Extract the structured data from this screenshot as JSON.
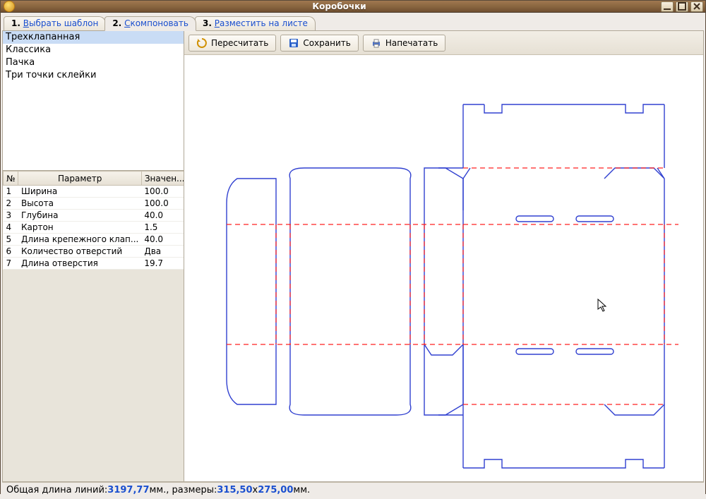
{
  "window": {
    "title": "Коробочки"
  },
  "tabs": [
    {
      "num": "1.",
      "label": "Выбрать шаблон",
      "ukey": "В"
    },
    {
      "num": "2.",
      "label": "Скомпоновать",
      "ukey": "С"
    },
    {
      "num": "3.",
      "label": "Разместить на листе",
      "ukey": "Р"
    }
  ],
  "templates": {
    "items": [
      "Трехклапанная",
      "Классика",
      "Пачка",
      "Три точки склейки"
    ],
    "selected": 0
  },
  "param_headers": {
    "num": "№",
    "name": "Параметр",
    "value": "Значен..."
  },
  "params": [
    {
      "n": "1",
      "name": "Ширина",
      "value": "100.0"
    },
    {
      "n": "2",
      "name": "Высота",
      "value": "100.0"
    },
    {
      "n": "3",
      "name": "Глубина",
      "value": "40.0"
    },
    {
      "n": "4",
      "name": "Картон",
      "value": "1.5"
    },
    {
      "n": "5",
      "name": "Длина крепежного клап...",
      "value": "40.0"
    },
    {
      "n": "6",
      "name": "Количество отверстий",
      "value": "Два"
    },
    {
      "n": "7",
      "name": "Длина отверстия",
      "value": "19.7"
    }
  ],
  "toolbar": {
    "recalc": "Пересчитать",
    "save": "Сохранить",
    "print": "Напечатать"
  },
  "status": {
    "prefix": "Общая длина линий: ",
    "length": "3197,77",
    "mid": " мм., размеры: ",
    "w": "315,50",
    "x": " x ",
    "h": "275,00",
    "suffix": " мм."
  }
}
